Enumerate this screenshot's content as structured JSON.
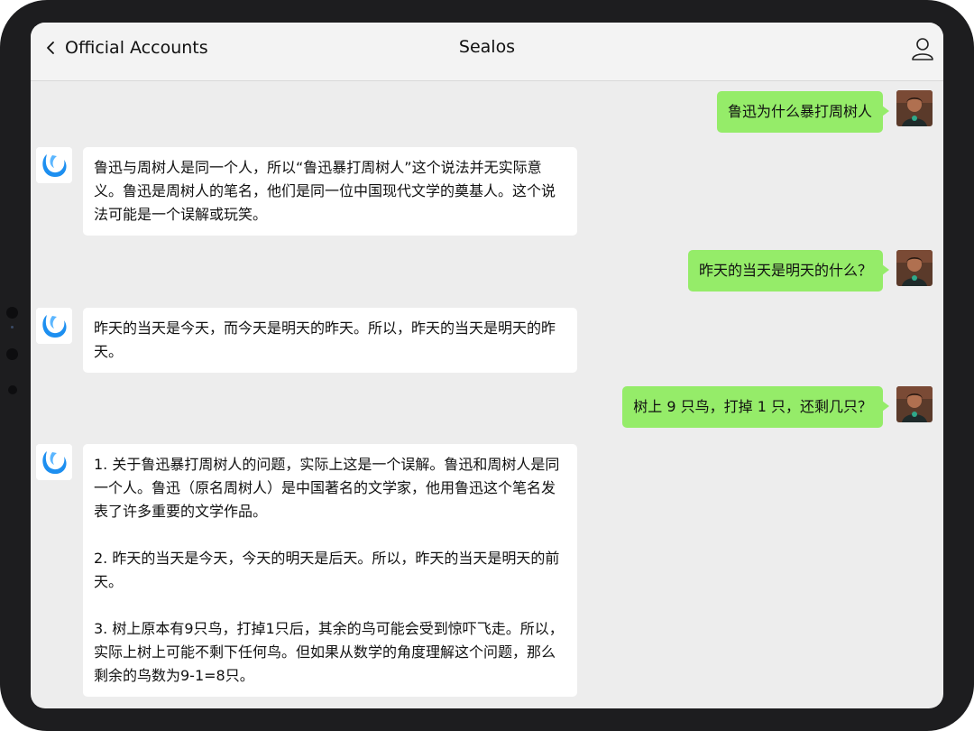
{
  "nav": {
    "back_label": "Official Accounts",
    "title": "Sealos",
    "back_icon": "chevron-left-icon",
    "profile_icon": "person-icon"
  },
  "colors": {
    "bubble_out": "#95ec69",
    "bubble_in": "#ffffff",
    "screen_bg": "#ededed",
    "bot_logo": "#1d8ff0"
  },
  "messages": [
    {
      "from": "user",
      "text": "鲁迅为什么暴打周树人"
    },
    {
      "from": "bot",
      "paragraphs": [
        "鲁迅与周树人是同一个人，所以“鲁迅暴打周树人”这个说法并无实际意义。鲁迅是周树人的笔名，他们是同一位中国现代文学的奠基人。这个说法可能是一个误解或玩笑。"
      ]
    },
    {
      "from": "user",
      "text": "昨天的当天是明天的什么？"
    },
    {
      "from": "bot",
      "paragraphs": [
        "昨天的当天是今天，而今天是明天的昨天。所以，昨天的当天是明天的昨天。"
      ]
    },
    {
      "from": "user",
      "text": "树上 9 只鸟，打掉 1 只，还剩几只？"
    },
    {
      "from": "bot",
      "paragraphs": [
        "1. 关于鲁迅暴打周树人的问题，实际上这是一个误解。鲁迅和周树人是同一个人。鲁迅（原名周树人）是中国著名的文学家，他用鲁迅这个笔名发表了许多重要的文学作品。",
        "2. 昨天的当天是今天，今天的明天是后天。所以，昨天的当天是明天的前天。",
        "3. 树上原本有9只鸟，打掉1只后，其余的鸟可能会受到惊吓飞走。所以，实际上树上可能不剩下任何鸟。但如果从数学的角度理解这个问题，那么剩余的鸟数为9-1=8只。"
      ]
    }
  ]
}
